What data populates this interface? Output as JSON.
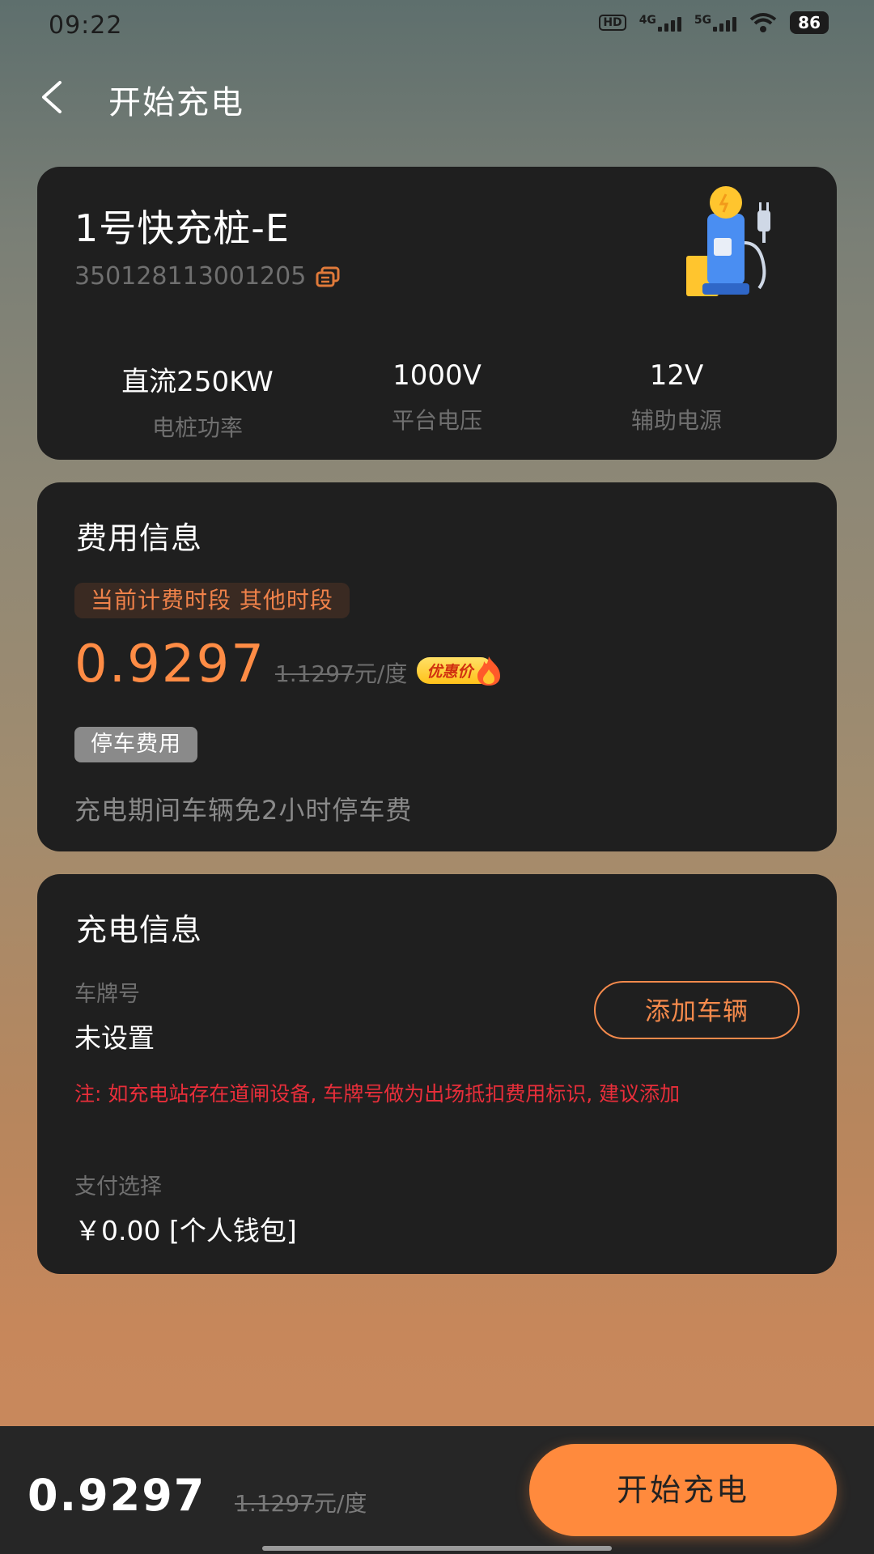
{
  "status_bar": {
    "time": "09:22",
    "hd": "HD",
    "net1": "4G",
    "net2": "5G",
    "battery": "86"
  },
  "header": {
    "title": "开始充电",
    "back_icon": "chevron-left-icon"
  },
  "station": {
    "name": "1号快充桩-E",
    "id": "350128113001205",
    "specs": [
      {
        "value": "直流250KW",
        "label": "电桩功率"
      },
      {
        "value": "1000V",
        "label": "平台电压"
      },
      {
        "value": "12V",
        "label": "辅助电源"
      }
    ]
  },
  "fee": {
    "title": "费用信息",
    "period_tag": "当前计费时段 其他时段",
    "price": "0.9297",
    "original_price": "1.1297",
    "unit": "元/度",
    "promo_label": "优惠价",
    "parking_tag": "停车费用",
    "parking_text": "充电期间车辆免2小时停车费"
  },
  "charge_info": {
    "title": "充电信息",
    "plate_label": "车牌号",
    "plate_value": "未设置",
    "add_vehicle_button": "添加车辆",
    "note": "注: 如充电站存在道闸设备, 车牌号做为出场抵扣费用标识, 建议添加",
    "payment_label": "支付选择",
    "payment_value": "￥0.00 [个人钱包]"
  },
  "bottom_bar": {
    "price": "0.9297",
    "original_price": "1.1297",
    "unit": "元/度",
    "start_button": "开始充电"
  },
  "colors": {
    "accent": "#ff8a3d",
    "card": "#1f1f1f",
    "warning": "#e82e3a"
  }
}
